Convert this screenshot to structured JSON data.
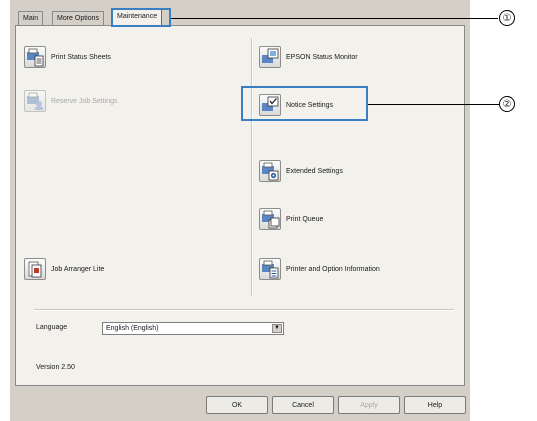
{
  "tabs": [
    {
      "label": "Main"
    },
    {
      "label": "More Options"
    },
    {
      "label": "Maintenance"
    }
  ],
  "left_items": [
    {
      "label": "Print Status Sheets",
      "enabled": true
    },
    {
      "label": "Reserve Job Settings",
      "enabled": false
    },
    {
      "label": "Job Arranger Lite",
      "enabled": true
    }
  ],
  "right_items": [
    {
      "label": "EPSON Status Monitor"
    },
    {
      "label": "Notice Settings"
    },
    {
      "label": "Extended Settings"
    },
    {
      "label": "Print Queue"
    },
    {
      "label": "Printer and Option Information"
    }
  ],
  "language": {
    "label": "Language",
    "value": "English (English)"
  },
  "version": "Version 2.50",
  "buttons": {
    "ok": "OK",
    "cancel": "Cancel",
    "apply": "Apply",
    "help": "Help"
  },
  "callouts": [
    "①",
    "②"
  ],
  "colors": {
    "highlight": "#3a7fc4",
    "panel": "#f2f1ec",
    "chrome": "#d4d0c8"
  }
}
